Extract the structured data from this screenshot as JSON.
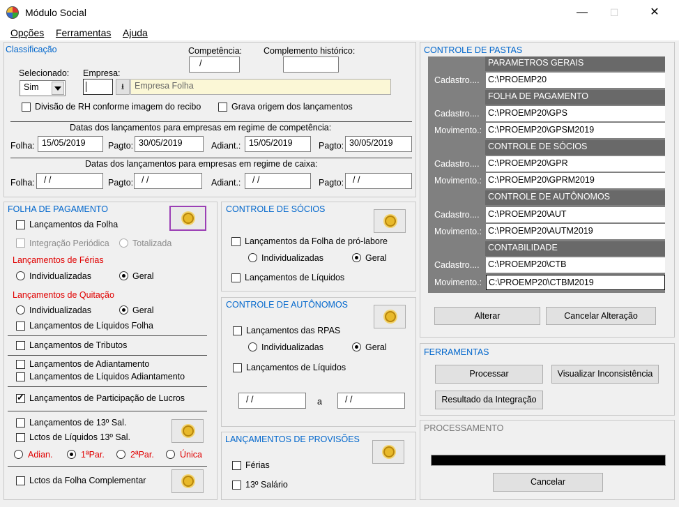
{
  "window": {
    "title": "Módulo Social",
    "minimize": "—",
    "maximize": "☐",
    "close": "✕"
  },
  "menu": {
    "opcoes": "Opções",
    "ferramentas": "Ferramentas",
    "ajuda": "Ajuda"
  },
  "classificacao": {
    "title": "Classificação",
    "competencia_label": "Competência:",
    "competencia_value": "/",
    "complemento_label": "Complemento histórico:",
    "complemento_value": "",
    "selecionado_label": "Selecionado:",
    "selecionado_value": "Sim",
    "empresa_label": "Empresa:",
    "empresa_code": "",
    "empresa_name": "Empresa Folha",
    "divisao_rh": "Divisão de RH conforme imagem do recibo",
    "grava_origem": "Grava origem dos lançamentos",
    "competencia_section": "Datas dos lançamentos para empresas em regime de competência:",
    "caixa_section": "Datas dos lançamentos para empresas em regime de caixa:",
    "folha_label": "Folha:",
    "pagto_label": "Pagto:",
    "adiant_label": "Adiant.:",
    "comp_folha": "15/05/2019",
    "comp_pagto": "30/05/2019",
    "comp_adiant": "15/05/2019",
    "comp_pagto2": "30/05/2019",
    "caixa_folha": "/ /",
    "caixa_pagto": "/ /",
    "caixa_adiant": "/ /",
    "caixa_pagto2": "/ /"
  },
  "folha": {
    "title": "FOLHA DE PAGAMENTO",
    "lancamentos_folha": "Lançamentos da Folha",
    "integracao_periodica": "Integração Periódica",
    "totalizada": "Totalizada",
    "lanc_ferias": "Lançamentos de Férias",
    "individualizadas": "Individualizadas",
    "geral": "Geral",
    "lanc_quitacao": "Lançamentos de Quitação",
    "liquidos_folha": "Lançamentos de Líquidos Folha",
    "tributos": "Lançamentos de Tributos",
    "adiantamento": "Lançamentos de Adiantamento",
    "liquidos_adiantamento": "Lançamentos de Líquidos Adiantamento",
    "participacao_lucros": "Lançamentos de Participação de Lucros",
    "decimo_terceiro": "Lançamentos de 13º Sal.",
    "liquidos_13": "Lctos de Líquidos 13º Sal.",
    "adian": "Adian.",
    "primeira_par": "1ªPar.",
    "segunda_par": "2ªPar.",
    "unica": "Única",
    "folha_complementar": "Lctos da Folha Complementar"
  },
  "socios": {
    "title": "CONTROLE DE SÓCIOS",
    "pro_labore": "Lançamentos da Folha de pró-labore",
    "individualizadas": "Individualizadas",
    "geral": "Geral",
    "liquidos": "Lançamentos de Líquidos"
  },
  "autonomos": {
    "title": "CONTROLE DE AUTÔNOMOS",
    "rpas": "Lançamentos das RPAS",
    "individualizadas": "Individualizadas",
    "geral": "Geral",
    "liquidos": "Lançamentos de Líquidos",
    "date_from": "/ /",
    "a_label": "a",
    "date_to": "/ /"
  },
  "provisoes": {
    "title": "LANÇAMENTOS DE PROVISÕES",
    "ferias": "Férias",
    "decimo": "13º Salário"
  },
  "pastas": {
    "title": "CONTROLE DE PASTAS",
    "cadastro_label": "Cadastro....",
    "movimento_label": "Movimento.:",
    "parametros_gerais": "PARAMETROS GERAIS",
    "pg_cadastro": "C:\\PROEMP20",
    "folha_pagamento": "FOLHA DE PAGAMENTO",
    "fp_cadastro": "C:\\PROEMP20\\GPS",
    "fp_movimento": "C:\\PROEMP20\\GPSM2019",
    "controle_socios": "CONTROLE DE SÓCIOS",
    "cs_cadastro": "C:\\PROEMP20\\GPR",
    "cs_movimento": "C:\\PROEMP20\\GPRM2019",
    "controle_autonomos": "CONTROLE DE AUTÔNOMOS",
    "ca_cadastro": "C:\\PROEMP20\\AUT",
    "ca_movimento": "C:\\PROEMP20\\AUTM2019",
    "contabilidade": "CONTABILIDADE",
    "ct_cadastro": "C:\\PROEMP20\\CTB",
    "ct_movimento": "C:\\PROEMP20\\CTBM2019",
    "alterar": "Alterar",
    "cancelar_alteracao": "Cancelar Alteração"
  },
  "ferramentas": {
    "title": "FERRAMENTAS",
    "processar": "Processar",
    "visualizar": "Visualizar Inconsistência",
    "resultado": "Resultado da Integração"
  },
  "processamento": {
    "title": "PROCESSAMENTO",
    "progress": 0,
    "cancelar": "Cancelar"
  }
}
